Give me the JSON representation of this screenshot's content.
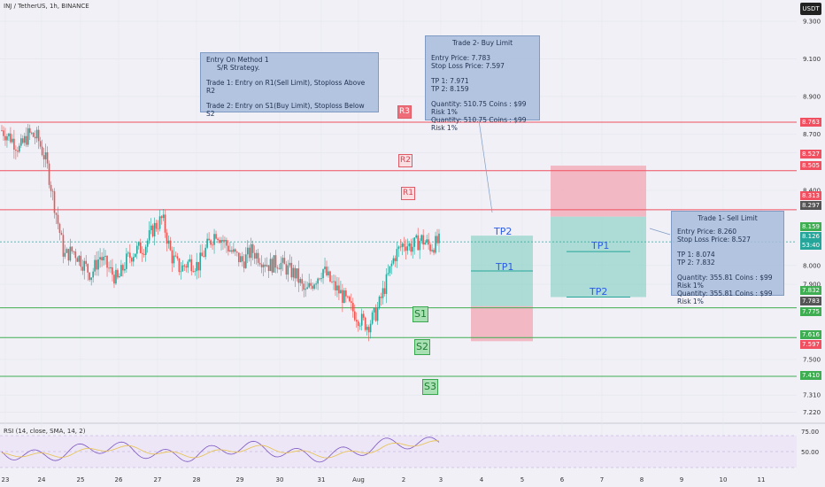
{
  "header": {
    "title": "INJ / TetherUS, 1h, BINANCE",
    "currency": "USDT"
  },
  "colors": {
    "resistance": "#f05060",
    "support": "#3fae52",
    "up_candle": "#26a69a",
    "down_candle": "#ef5350",
    "price_line": "#26a69a"
  },
  "notes": {
    "strategy": {
      "line1": "Entry On Method 1",
      "line2": "S/R Strategy.",
      "line3": "Trade 1: Entry on R1(Sell Limit), Stoploss Above R2",
      "line4": "Trade 2: Entry on S1(Buy Limit), Stoploss Below S2"
    },
    "trade2": {
      "title": "Trade 2- Buy Limit",
      "entry": "Entry Price: 7.783",
      "stop": "Stop Loss Price: 7.597",
      "tp1": "TP 1: 7.971",
      "tp2": "TP 2: 8.159",
      "qty1": "Quantity: 510.75 Coins : $99 Risk 1%",
      "qty2": "Quantity: 510.75 Coins : $99 Risk 1%"
    },
    "trade1": {
      "title": "Trade 1- Sell Limit",
      "entry": "Entry Price: 8.260",
      "stop": "Stop Loss Price: 8.527",
      "tp1": "TP 1: 8.074",
      "tp2": "TP 2: 7.832",
      "qty1": "Quantity: 355.81 Coins : $99 Risk 1%",
      "qty2": "Quantity: 355.81 Coins : $99 Risk 1%"
    }
  },
  "levels": {
    "R1": {
      "label": "R1",
      "price": 8.297
    },
    "R2": {
      "label": "R2",
      "price": 8.505
    },
    "R3": {
      "label": "R3",
      "price": 8.763
    },
    "S1": {
      "label": "S1",
      "price": 7.775
    },
    "S2": {
      "label": "S2",
      "price": 7.616
    },
    "S3": {
      "label": "S3",
      "price": 7.41
    }
  },
  "axis_tags": [
    {
      "text": "8.763",
      "color": "#f05060"
    },
    {
      "text": "8.527",
      "color": "#f05060"
    },
    {
      "text": "8.505",
      "color": "#f05060"
    },
    {
      "text": "8.313",
      "color": "#f05060"
    },
    {
      "text": "8.297",
      "color": "#555555"
    },
    {
      "text": "8.159",
      "color": "#3fae52"
    },
    {
      "text": "8.126",
      "color": "#26a69a"
    },
    {
      "text": "53:40",
      "color": "#26a69a"
    },
    {
      "text": "7.832",
      "color": "#3fae52"
    },
    {
      "text": "7.783",
      "color": "#555555"
    },
    {
      "text": "7.775",
      "color": "#3fae52"
    },
    {
      "text": "7.616",
      "color": "#3fae52"
    },
    {
      "text": "7.597",
      "color": "#f05060"
    },
    {
      "text": "7.410",
      "color": "#3fae52"
    }
  ],
  "tp_labels": {
    "tp1": "TP1",
    "tp2": "TP2"
  },
  "rsi": {
    "label": "RSI (14, close, SMA, 14, 2)",
    "ticks": [
      "75.00",
      "50.00"
    ]
  },
  "chart_data": {
    "type": "candlestick",
    "title": "INJ / TetherUS, 1h, BINANCE",
    "y_ticks": [
      9.3,
      9.1,
      8.9,
      8.7,
      8.6,
      8.4,
      8.0,
      7.9,
      7.5,
      7.31,
      7.22
    ],
    "y_tick_labels": [
      "9.300",
      "9.100",
      "8.900",
      "8.700",
      "8.600",
      "8.400",
      "8.000",
      "7.900",
      "7.500",
      "7.310",
      "7.220"
    ],
    "x_tick_labels": [
      "23",
      "24",
      "25",
      "26",
      "27",
      "28",
      "29",
      "30",
      "31",
      "Aug",
      "2",
      "3",
      "4",
      "5",
      "6",
      "7",
      "8",
      "9",
      "10",
      "11"
    ],
    "current_price": 8.126,
    "trade2_buy": {
      "entry": 7.783,
      "stop": 7.597,
      "tp1": 7.971,
      "tp2": 8.159
    },
    "trade1_sell": {
      "entry": 8.26,
      "stop": 8.527,
      "tp1": 8.074,
      "tp2": 7.832
    },
    "trend_close": [
      8.72,
      8.68,
      8.62,
      8.7,
      8.68,
      8.55,
      8.3,
      8.05,
      8.08,
      8.02,
      7.95,
      8.05,
      7.98,
      7.92,
      8.03,
      8.08,
      8.1,
      8.2,
      8.25,
      8.05,
      7.98,
      8.02,
      8.0,
      8.1,
      8.18,
      8.12,
      8.06,
      8.02,
      8.08,
      8.04,
      8.0,
      8.02,
      7.98,
      7.95,
      7.85,
      7.92,
      7.98,
      7.9,
      7.85,
      7.78,
      7.72,
      7.68,
      7.75,
      7.9,
      8.05,
      8.12,
      8.1,
      8.14,
      8.1,
      8.126
    ]
  }
}
